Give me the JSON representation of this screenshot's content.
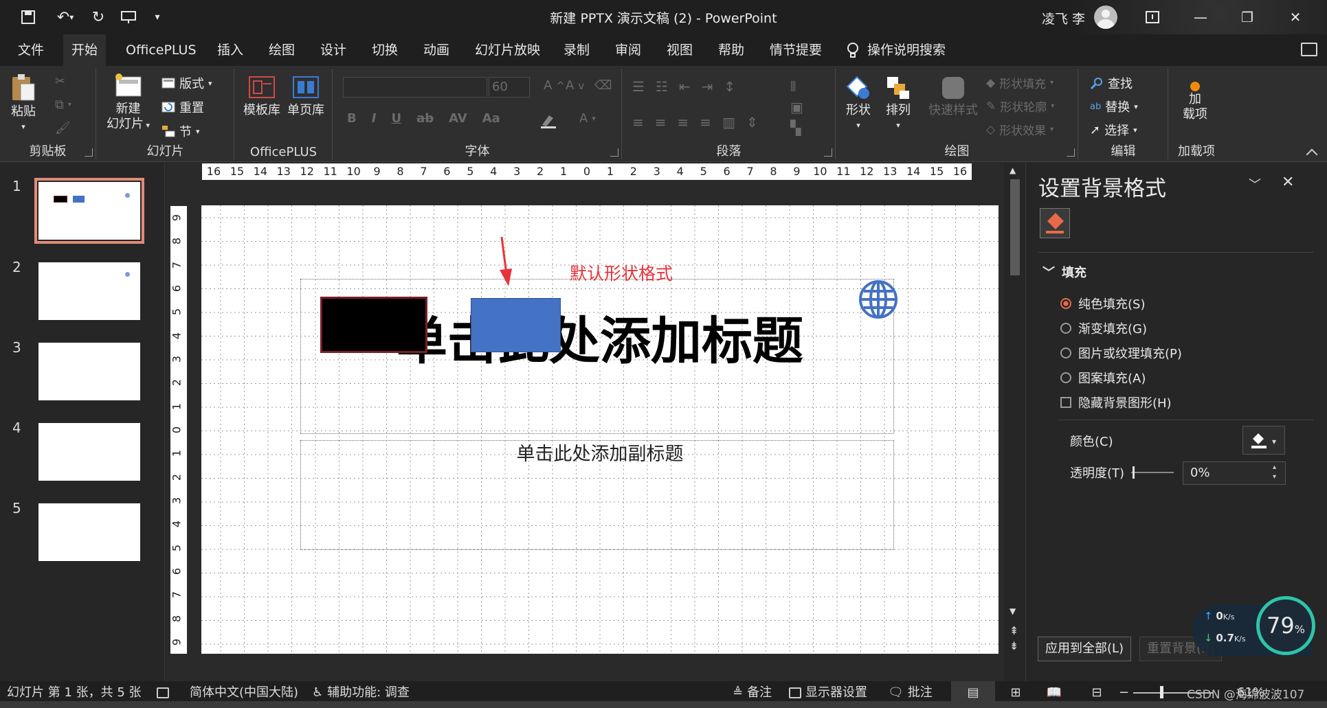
{
  "window": {
    "title": "新建 PPTX 演示文稿 (2)  -  PowerPoint",
    "user": "凌飞 李"
  },
  "tabs": [
    "文件",
    "开始",
    "OfficePLUS",
    "插入",
    "绘图",
    "设计",
    "切换",
    "动画",
    "幻灯片放映",
    "录制",
    "审阅",
    "视图",
    "帮助",
    "情节提要"
  ],
  "active_tab": "开始",
  "tell_me": "操作说明搜索",
  "ribbon": {
    "clipboard": {
      "label": "剪贴板",
      "paste": "粘贴"
    },
    "slides": {
      "label": "幻灯片",
      "new_slide_1": "新建",
      "new_slide_2": "幻灯片",
      "layout": "版式",
      "reset": "重置",
      "section": "节"
    },
    "officeplus": {
      "label": "OfficePLUS",
      "templates": "模板库",
      "single_page": "单页库"
    },
    "font": {
      "label": "字体",
      "size": "60"
    },
    "paragraph": {
      "label": "段落"
    },
    "drawing": {
      "label": "绘图",
      "shapes": "形状",
      "arrange": "排列",
      "quick_styles": "快速样式",
      "shape_fill": "形状填充",
      "shape_outline": "形状轮廓",
      "shape_effects": "形状效果"
    },
    "editing": {
      "label": "编辑",
      "find": "查找",
      "replace": "替换",
      "select": "选择"
    },
    "addins": {
      "label": "加载项",
      "addins_1": "加",
      "addins_2": "载项"
    }
  },
  "thumbnails": [
    "1",
    "2",
    "3",
    "4",
    "5"
  ],
  "ruler": {
    "h": [
      "16",
      "15",
      "14",
      "13",
      "12",
      "11",
      "10",
      "9",
      "8",
      "7",
      "6",
      "5",
      "4",
      "3",
      "2",
      "1",
      "0",
      "1",
      "2",
      "3",
      "4",
      "5",
      "6",
      "7",
      "8",
      "9",
      "10",
      "11",
      "12",
      "13",
      "14",
      "15",
      "16"
    ],
    "v": [
      "9",
      "8",
      "7",
      "6",
      "5",
      "4",
      "3",
      "2",
      "1",
      "0",
      "1",
      "2",
      "3",
      "4",
      "5",
      "6",
      "7",
      "8",
      "9"
    ]
  },
  "slide": {
    "annotation": "默认形状格式",
    "title_placeholder": "单击此处添加标题",
    "subtitle_placeholder": "单击此处添加副标题"
  },
  "pane": {
    "title": "设置背景格式",
    "section": "填充",
    "options": [
      "纯色填充(S)",
      "渐变填充(G)",
      "图片或纹理填充(P)",
      "图案填充(A)"
    ],
    "selected_option": "纯色填充(S)",
    "hide_bg": "隐藏背景图形(H)",
    "color_label": "颜色(C)",
    "transparency_label": "透明度(T)",
    "transparency_value": "0%",
    "apply_all": "应用到全部(L)",
    "reset_bg": "重置背景(B)"
  },
  "network": {
    "up": "0",
    "up_unit": "K/s",
    "down": "0.7",
    "down_unit": "K/s",
    "cpu": "79",
    "cpu_unit": "%"
  },
  "status": {
    "slide_info": "幻灯片 第 1 张，共 5 张",
    "language": "简体中文(中国大陆)",
    "accessibility": "辅助功能: 调查",
    "notes": "备注",
    "display": "显示器设置",
    "comments": "批注",
    "zoom": "61%",
    "watermark": "CSDN @海绵波波107"
  },
  "colors": {
    "accent": "#e86a4a",
    "shape_blue": "#4472c4",
    "annotation_red": "#e8323a"
  }
}
